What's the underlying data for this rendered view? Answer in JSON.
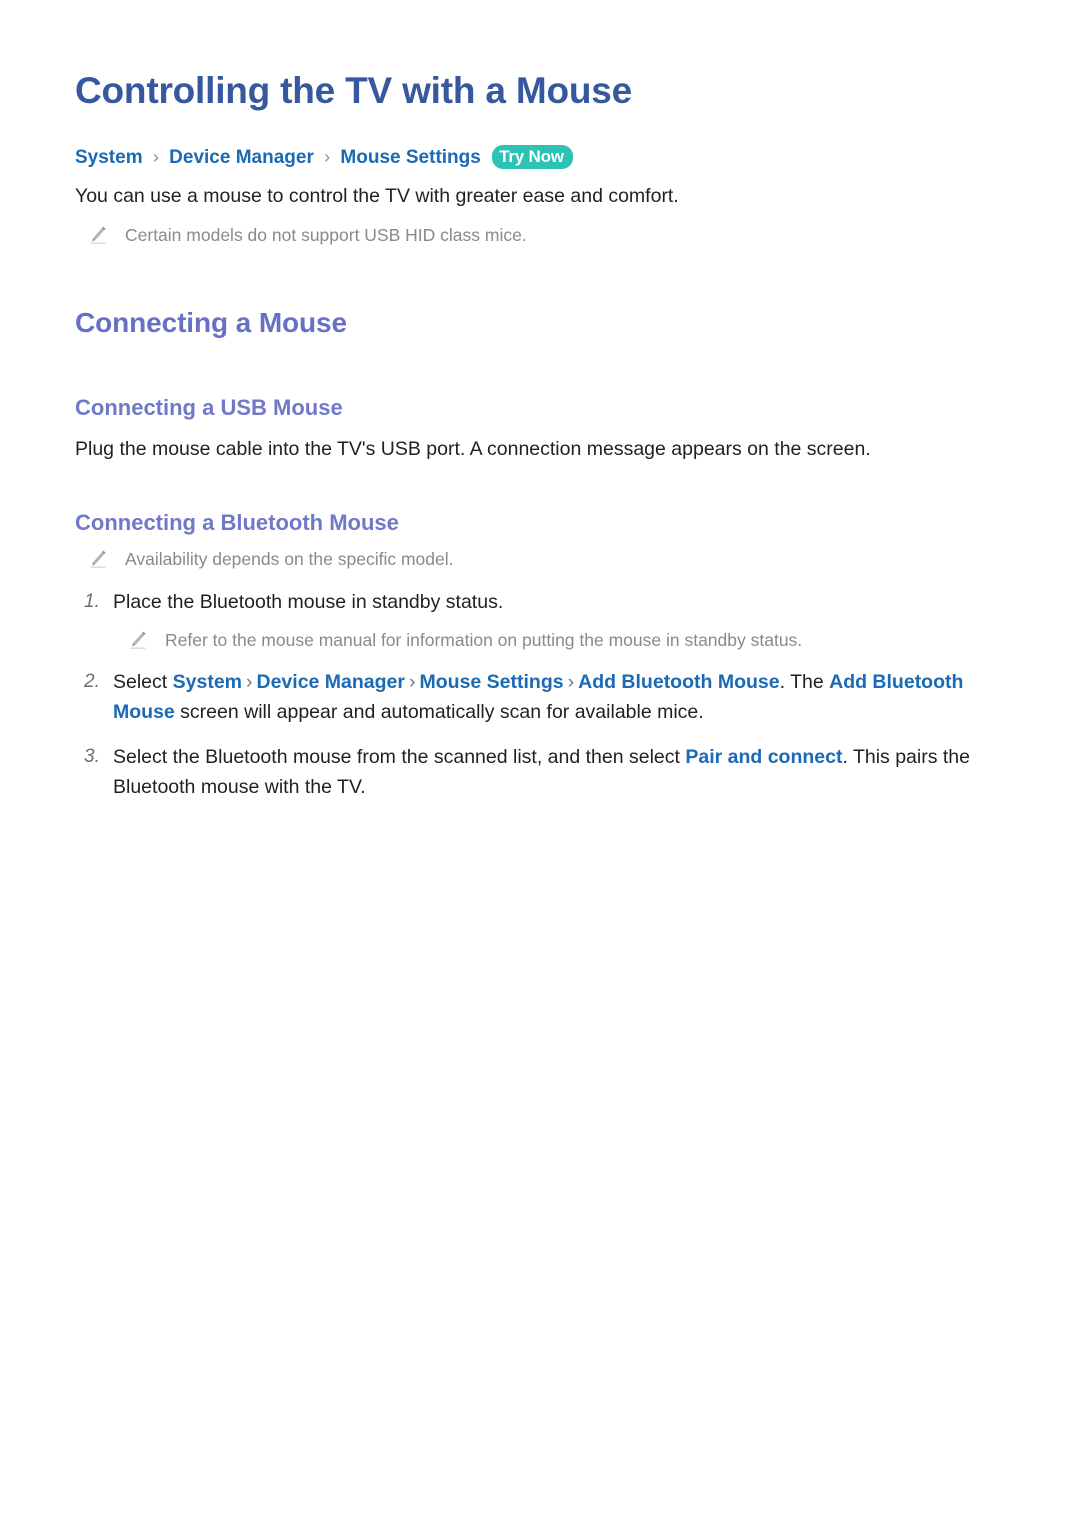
{
  "document": {
    "title": "Controlling the TV with a Mouse"
  },
  "breadcrumb": {
    "items": [
      "System",
      "Device Manager",
      "Mouse Settings"
    ],
    "separator": "›",
    "badge": "Try Now"
  },
  "intro": {
    "paragraph": "You can use a mouse to control the TV with greater ease and comfort.",
    "note": "Certain models do not support USB HID class mice."
  },
  "sections": {
    "connecting_a_mouse": {
      "heading": "Connecting a Mouse",
      "usb": {
        "heading": "Connecting a USB Mouse",
        "paragraph": "Plug the mouse cable into the TV's USB port. A connection message appears on the screen."
      },
      "bluetooth": {
        "heading": "Connecting a Bluetooth Mouse",
        "note": "Availability depends on the specific model.",
        "steps": [
          {
            "number": "1.",
            "text": "Place the Bluetooth mouse in standby status.",
            "note": "Refer to the mouse manual for information on putting the mouse in standby status."
          },
          {
            "number": "2.",
            "segments": [
              {
                "type": "text",
                "value": "Select "
              },
              {
                "type": "link",
                "value": "System"
              },
              {
                "type": "sep",
                "value": "›"
              },
              {
                "type": "link",
                "value": "Device Manager"
              },
              {
                "type": "sep",
                "value": "›"
              },
              {
                "type": "link",
                "value": "Mouse Settings"
              },
              {
                "type": "sep",
                "value": "›"
              },
              {
                "type": "link",
                "value": "Add Bluetooth Mouse"
              },
              {
                "type": "text",
                "value": ". The "
              },
              {
                "type": "link",
                "value": "Add Bluetooth Mouse"
              },
              {
                "type": "text",
                "value": " screen will appear and automatically scan for available mice."
              }
            ]
          },
          {
            "number": "3.",
            "segments": [
              {
                "type": "text",
                "value": "Select the Bluetooth mouse from the scanned list, and then select "
              },
              {
                "type": "link",
                "value": "Pair and connect"
              },
              {
                "type": "text",
                "value": ". This pairs the Bluetooth mouse with the TV."
              }
            ]
          }
        ]
      }
    }
  },
  "icons": {
    "note": "pencil-icon"
  },
  "colors": {
    "title_blue": "#35589f",
    "heading_periwinkle": "#6670c4",
    "link_blue": "#1a6ab5",
    "badge_teal": "#2cc2b4",
    "note_gray": "#8a8a8a",
    "body_text": "#231f20"
  }
}
